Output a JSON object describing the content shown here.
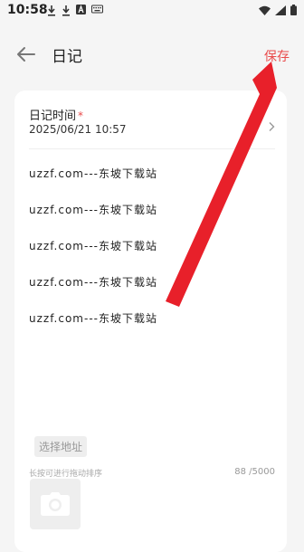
{
  "status_bar": {
    "time": "10:58",
    "left_icons": [
      "download-icon",
      "download-icon",
      "text-a-icon",
      "keyboard-icon"
    ],
    "right_icons": [
      "wifi-icon",
      "signal-icon",
      "battery-icon"
    ]
  },
  "header": {
    "title": "日记",
    "save_label": "保存",
    "back_icon": "arrow-left-icon"
  },
  "form": {
    "time_label": "日记时间",
    "required_mark": "*",
    "time_value": "2025/06/21 10:57",
    "entries": [
      "uzzf.com---东坡下载站",
      "uzzf.com---东坡下载站",
      "uzzf.com---东坡下载站",
      "uzzf.com---东坡下载站",
      "uzzf.com---东坡下载站"
    ],
    "address_button": "选择地址",
    "photo_hint": "长按可进行拖动排序",
    "char_count": "88 /5000",
    "photo_icon": "camera-icon"
  },
  "colors": {
    "accent": "#e94b4b",
    "background": "#f5f5f5",
    "card": "#ffffff"
  }
}
